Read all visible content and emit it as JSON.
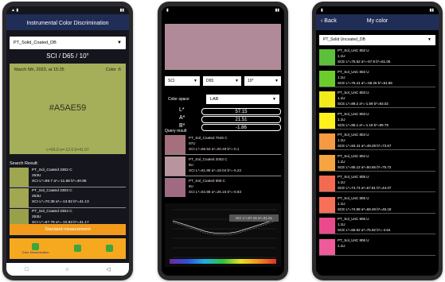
{
  "phone1": {
    "header": "Instrumental Color Discrimination",
    "dropdown": "PT_Solid_Coated_DB",
    "mode": "SCI / D65 / 10°",
    "date": "March 5th, 2023, at 15:25",
    "color_no": "Color :6",
    "hex": "#A5AE59",
    "lab": "L=69.0  a=-12.6  b=41.97",
    "search_label": "Search Result:",
    "results": [
      {
        "name": "PT_Sol_Coated 2302 C",
        "code": "253U",
        "values": "SCI  L*=69.7  a*=-11.66  b*=40.85"
      },
      {
        "name": "PT_Sol_Coated 2303 C",
        "code": "253U",
        "values": "SCI  L*=70.38  a*=-13.82  b*=41.13"
      },
      {
        "name": "PT_Sol_Coated 2304 C",
        "code": "253U",
        "values": "SCI  L*=67.79  a*=-10.83  b*=41.17"
      }
    ],
    "standard_button": "Standard measurement",
    "tabs": [
      "Color Discrimination",
      "",
      ""
    ],
    "nav": [
      "□",
      "○",
      "◁"
    ]
  },
  "phone2": {
    "swatch_color": "#b08a99",
    "selectors": [
      "SCI",
      "D65",
      "10°"
    ],
    "color_space_label": "Color space",
    "color_space": "LAB",
    "lab": [
      {
        "label": "L*",
        "value": "57.15"
      },
      {
        "label": "A*",
        "value": "21.51"
      },
      {
        "label": "B*",
        "value": "-1.86"
      }
    ],
    "query_label": "Query result",
    "results": [
      {
        "name": "PT_Sol_Coated 7646 C",
        "code": "97U",
        "values": "SCI  L*=56.53  a*=20.49  b*=-0.1",
        "color": "#a4707e"
      },
      {
        "name": "PT_Sol_Coated 2053 C",
        "code": "8U",
        "values": "SCI  L*=61.88  a*=18.04  b*=-5.22",
        "color": "#b8949f"
      },
      {
        "name": "PT_Sol_Coated 688 C",
        "code": "8U",
        "values": "SCI  L*=54.98  a*=26.15  b*=-6.83",
        "color": "#a06a83"
      }
    ],
    "tooltip": "SCI  L*=57.15  a*=21.51"
  },
  "phone3": {
    "back": "Back",
    "title": "My color",
    "dropdown": "PT_Solid Uncoated_DB",
    "items": [
      {
        "name": "PT_Sol_UnC 802 U",
        "code": "1.1U",
        "values": "SCE  L*=75.52  a*=-67.9  b*=61.06",
        "color": "#5cc03a"
      },
      {
        "name": "PT_Sol_UnC 802 U",
        "code": "1.1U",
        "values": "SCE  L*=75.41  a*=-58.26  b*=61.86",
        "color": "#6ccc2c"
      },
      {
        "name": "PT_Sol_UnC 803 U",
        "code": "1.1U",
        "values": "SCE  L*=89.2  a*=-1.59  b*=93.02",
        "color": "#f2ea1a"
      },
      {
        "name": "PT_Sol_UnC 803 U",
        "code": "1.1U",
        "values": "SCE  L*=95.1  a*=-1.18  b*=99.79",
        "color": "#fff21c"
      },
      {
        "name": "PT_Sol_UnC 804 U",
        "code": "1.1U",
        "values": "SCE  L*=84.41  a*=49.28  b*=73.67",
        "color": "#f49a40"
      },
      {
        "name": "PT_Sol_UnC 804 U",
        "code": "1.1U",
        "values": "SCE  L*=85.12  a*=50.65  b*=75.72",
        "color": "#f6a440"
      },
      {
        "name": "PT_Sol_UnC 805 U",
        "code": "1.1U",
        "values": "SCE  L*=74.74  a*=67.81  b*=44.07",
        "color": "#f46a50"
      },
      {
        "name": "PT_Sol_UnC 805 U",
        "code": "1.1U",
        "values": "SCE  L*=74.98  a*=68.49  b*=45.18",
        "color": "#f67058"
      },
      {
        "name": "PT_Sol_UnC 806 U",
        "code": "1.1U",
        "values": "SCE  L*=66.92  a*=75.92  b*=-4.64",
        "color": "#ea4a8c"
      },
      {
        "name": "PT_Sol_UnC 806 U",
        "code": "1.1U",
        "values": "",
        "color": "#ee5a9a"
      }
    ]
  }
}
